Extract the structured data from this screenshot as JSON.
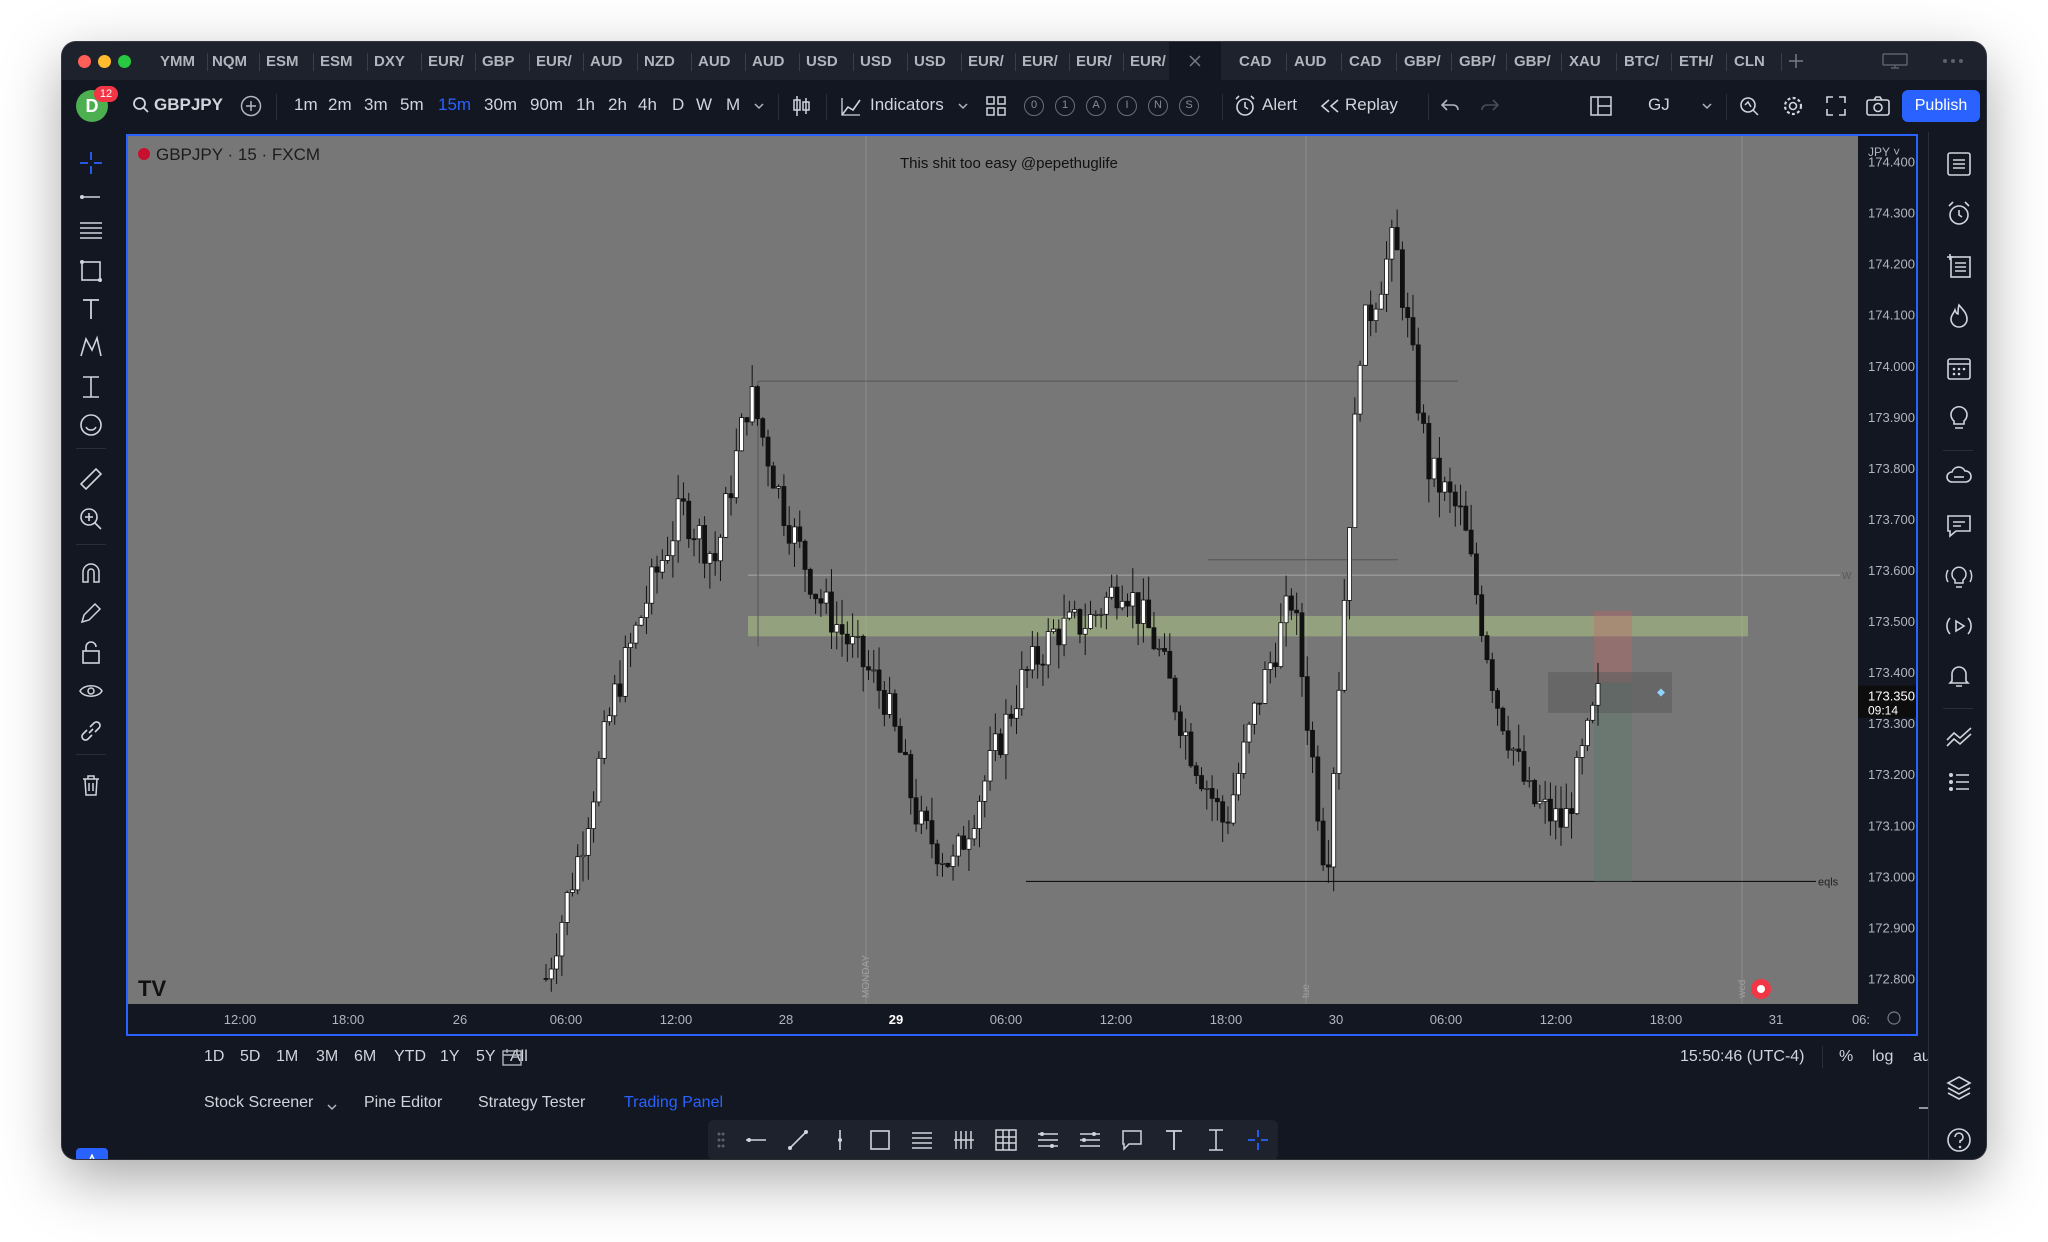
{
  "tabs": [
    "YMM",
    "NQM",
    "ESM",
    "ESM",
    "DXY",
    "EUR/",
    "GBP",
    "EUR/",
    "AUD",
    "NZD",
    "AUD",
    "AUD",
    "USD",
    "USD",
    "USD",
    "EUR/",
    "EUR/",
    "EUR/",
    "EUR/",
    "CAD",
    "AUD",
    "CAD",
    "GBP/",
    "GBP/",
    "GBP/",
    "XAU",
    "BTC/",
    "ETH/",
    "CLN"
  ],
  "toolbar": {
    "avatar_letter": "D",
    "notification_count": "12",
    "symbol": "GBPJPY",
    "intervals": [
      "1m",
      "2m",
      "3m",
      "5m",
      "15m",
      "30m",
      "90m",
      "1h",
      "2h",
      "4h",
      "D",
      "W",
      "M"
    ],
    "active_interval": "15m",
    "indicators_label": "Indicators",
    "circle_buttons": [
      "0",
      "1",
      "A",
      "I",
      "N",
      "S"
    ],
    "alert_label": "Alert",
    "replay_label": "Replay",
    "layout_name": "GJ",
    "publish_label": "Publish"
  },
  "chart": {
    "legend": "GBPJPY · 15 · FXCM",
    "annotation": "This shit too easy @pepethuglife",
    "currency": "JPY",
    "price_ticks": [
      "174.400",
      "174.300",
      "174.200",
      "174.100",
      "174.000",
      "173.900",
      "173.800",
      "173.700",
      "173.600",
      "173.500",
      "173.400",
      "173.300",
      "173.200",
      "173.100",
      "173.000",
      "172.900",
      "172.800"
    ],
    "current_price": "173.350",
    "countdown": "09:14",
    "time_ticks": [
      "12:00",
      "18:00",
      "26",
      "06:00",
      "12:00",
      "28",
      "29",
      "06:00",
      "12:00",
      "18:00",
      "30",
      "06:00",
      "12:00",
      "18:00",
      "31",
      "06:"
    ],
    "day_labels": [
      "MONDAY",
      "tue",
      "wed"
    ],
    "line_labels": [
      "W",
      "eqls"
    ],
    "logo": "TV"
  },
  "chart_data": {
    "type": "candlestick",
    "symbol": "GBPJPY",
    "interval": "15",
    "ylim": [
      172.75,
      174.45
    ],
    "y_unit": "JPY",
    "close_samples": [
      172.8,
      173.05,
      173.35,
      173.55,
      173.72,
      173.62,
      173.95,
      173.72,
      173.55,
      173.45,
      173.35,
      173.1,
      173.02,
      173.2,
      173.38,
      173.48,
      173.5,
      173.58,
      173.45,
      173.25,
      173.1,
      173.35,
      173.55,
      173.0,
      174.05,
      174.25,
      173.8,
      173.7,
      173.35,
      173.15,
      173.1,
      173.35
    ],
    "levels": [
      {
        "label": "W",
        "price": 173.59
      },
      {
        "label": "eqls",
        "price": 172.99
      },
      {
        "label": "",
        "price": 173.97
      },
      {
        "label": "",
        "price": 173.62
      }
    ],
    "zone": {
      "from": 173.47,
      "to": 173.51
    }
  },
  "bottombar": {
    "ranges": [
      "1D",
      "5D",
      "1M",
      "3M",
      "6M",
      "YTD",
      "1Y",
      "5Y",
      "All"
    ],
    "clock": "15:50:46 (UTC-4)",
    "pct": "%",
    "log": "log",
    "auto": "auto"
  },
  "panel": {
    "tabs": [
      "Stock Screener",
      "Pine Editor",
      "Strategy Tester",
      "Trading Panel"
    ],
    "active": "Trading Panel"
  },
  "colors": {
    "accent": "#2962ff",
    "chart_bg": "#777777",
    "zone": "#b8d48a"
  }
}
